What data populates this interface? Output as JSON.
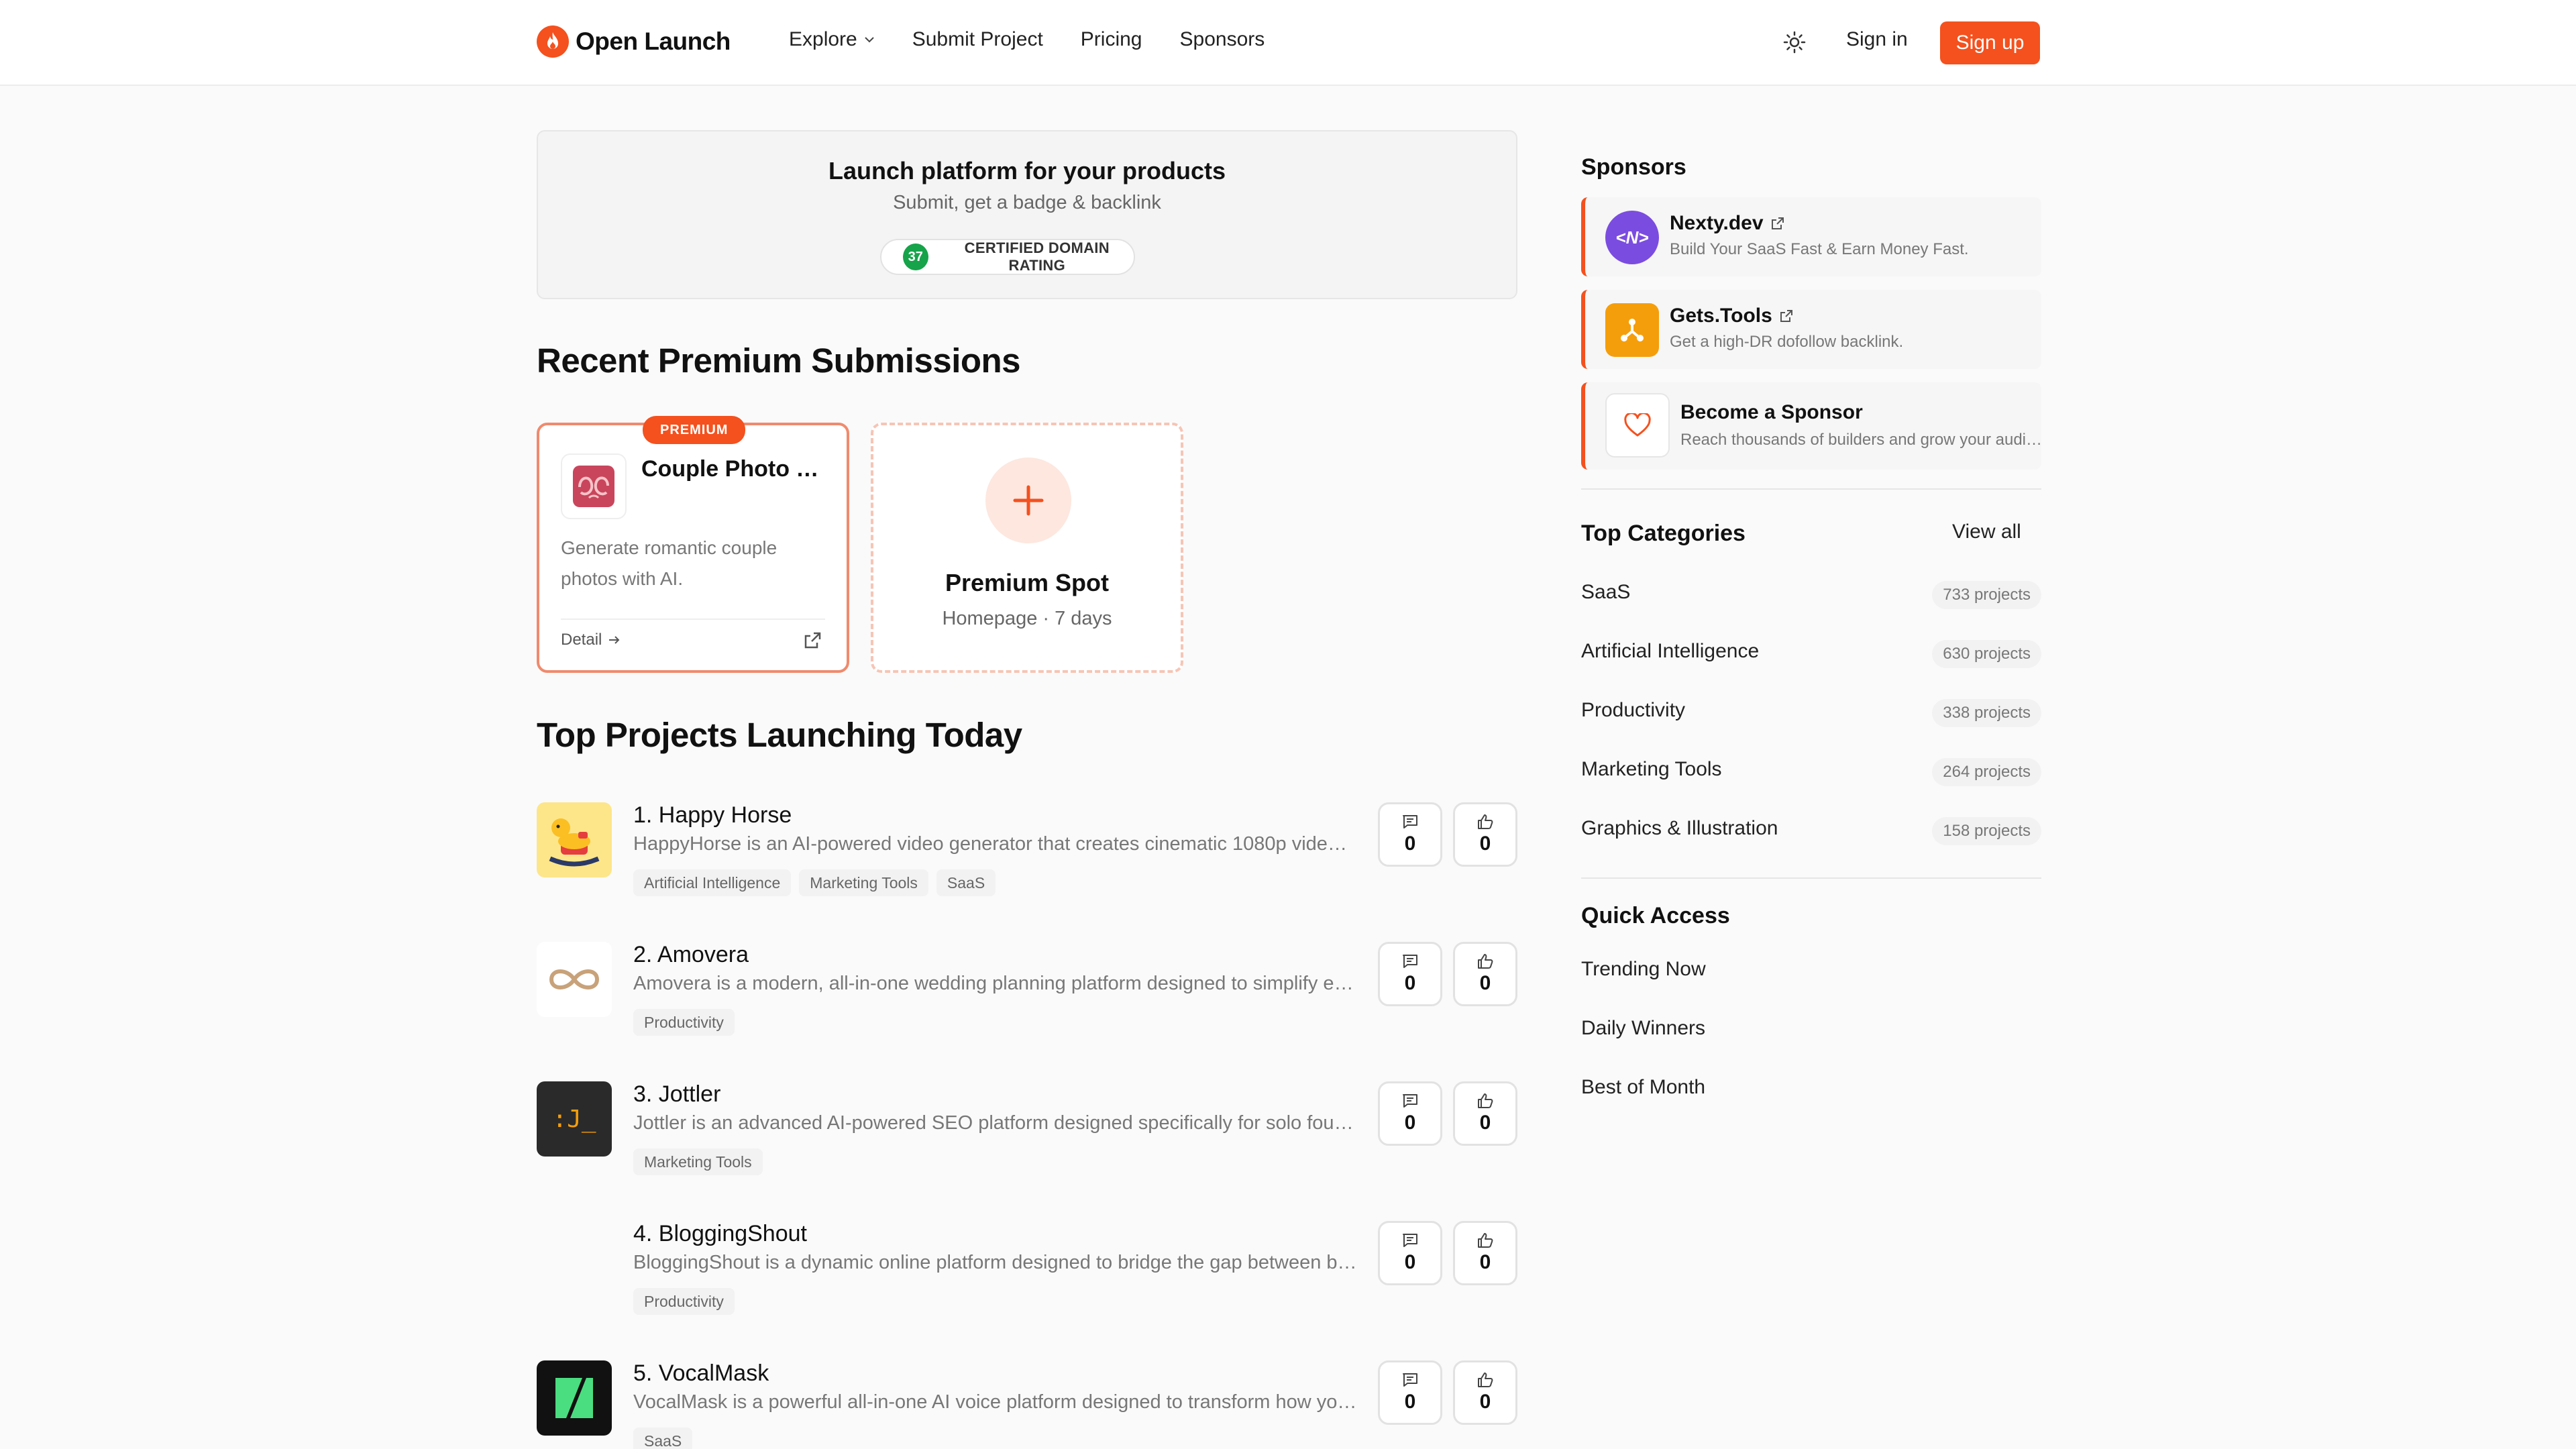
{
  "header": {
    "logo_text": "Open Launch",
    "nav": [
      {
        "label": "Explore",
        "has_dropdown": true
      },
      {
        "label": "Submit Project"
      },
      {
        "label": "Pricing"
      },
      {
        "label": "Sponsors"
      }
    ],
    "signin_label": "Sign in",
    "signup_label": "Sign up"
  },
  "hero": {
    "title": "Launch platform for your products",
    "subtitle": "Submit, get a badge & backlink",
    "dr_value": "37",
    "dr_label": "CERTIFIED DOMAIN RATING"
  },
  "premium": {
    "section_title": "Recent Premium Submissions",
    "card": {
      "tag": "PREMIUM",
      "name": "Couple Photo Generator",
      "description": "Generate romantic couple photos with AI.",
      "detail_label": "Detail"
    },
    "spot": {
      "title": "Premium Spot",
      "subtitle": "Homepage · 7 days"
    }
  },
  "projects": {
    "section_title": "Top Projects Launching Today",
    "items": [
      {
        "name": "1. Happy Horse",
        "description": "HappyHorse is an AI-powered video generator that creates cinematic 1080p videos from text or images.",
        "tags": [
          "Artificial Intelligence",
          "Marketing Tools",
          "SaaS"
        ],
        "comments": "0",
        "votes": "0"
      },
      {
        "name": "2. Amovera",
        "description": "Amovera is a modern, all-in-one wedding planning platform designed to simplify every step.",
        "tags": [
          "Productivity"
        ],
        "comments": "0",
        "votes": "0"
      },
      {
        "name": "3. Jottler",
        "description": "Jottler is an advanced AI-powered SEO platform designed specifically for solo founders.",
        "tags": [
          "Marketing Tools"
        ],
        "comments": "0",
        "votes": "0"
      },
      {
        "name": "4. BloggingShout",
        "description": "BloggingShout is a dynamic online platform designed to bridge the gap between bloggers.",
        "tags": [
          "Productivity"
        ],
        "comments": "0",
        "votes": "0"
      },
      {
        "name": "5. VocalMask",
        "description": "VocalMask is a powerful all-in-one AI voice platform designed to transform how you speak.",
        "tags": [
          "SaaS"
        ],
        "comments": "0",
        "votes": "0"
      }
    ]
  },
  "sidebar": {
    "sponsors_title": "Sponsors",
    "sponsors": [
      {
        "name": "Nexty.dev",
        "description": "Build Your SaaS Fast & Earn Money Fast.",
        "logo_text": "<N>",
        "color": "#7b4ce0"
      },
      {
        "name": "Gets.Tools",
        "description": "Get a high-DR dofollow backlink.",
        "color": "#f59e0b"
      },
      {
        "name": "Become a Sponsor",
        "description": "Reach thousands of builders and grow your audience."
      }
    ],
    "categories_title": "Top Categories",
    "view_all_label": "View all",
    "categories": [
      {
        "name": "SaaS",
        "count": "733 projects"
      },
      {
        "name": "Artificial Intelligence",
        "count": "630 projects"
      },
      {
        "name": "Productivity",
        "count": "338 projects"
      },
      {
        "name": "Marketing Tools",
        "count": "264 projects"
      },
      {
        "name": "Graphics & Illustration",
        "count": "158 projects"
      }
    ],
    "quick_access_title": "Quick Access",
    "quick_access": [
      "Trending Now",
      "Daily Winners",
      "Best of Month"
    ]
  },
  "colors": {
    "accent": "#f4511e",
    "success": "#16a34a"
  }
}
